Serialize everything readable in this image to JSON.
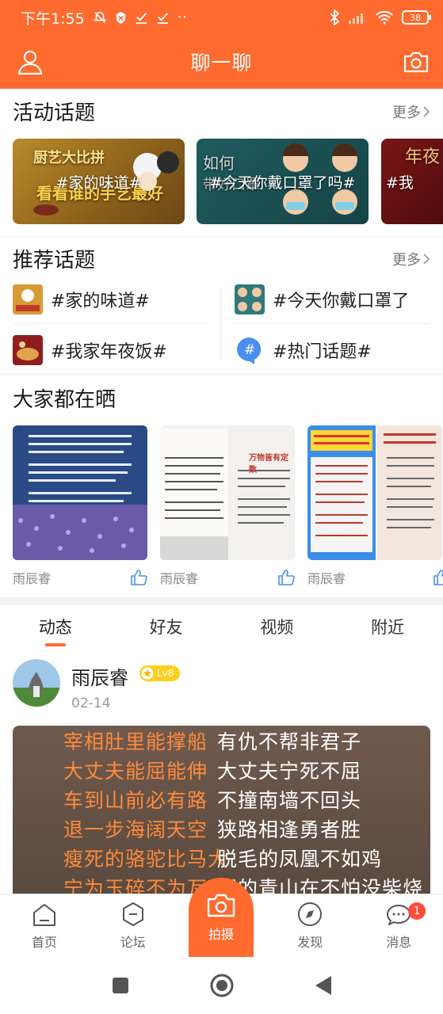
{
  "status_bar": {
    "time": "下午1:55",
    "battery": "38",
    "dots": "··"
  },
  "header": {
    "title": "聊一聊"
  },
  "activity": {
    "title": "活动话题",
    "more": "更多",
    "banners": [
      {
        "caption": "#家的味道#",
        "art_text": "厨艺大比拼 看看谁的手艺最好"
      },
      {
        "caption": "#今天你戴口罩了吗#",
        "art_text": "如何 带好口罩"
      },
      {
        "caption": "#我",
        "art_text": "年夜"
      }
    ]
  },
  "recommended": {
    "title": "推荐话题",
    "more": "更多",
    "topics": [
      {
        "label": "#家的味道#"
      },
      {
        "label": "#今天你戴口罩了"
      },
      {
        "label": "#我家年夜饭#"
      },
      {
        "label": "#热门话题#"
      }
    ]
  },
  "showcase": {
    "title": "大家都在晒",
    "posts": [
      {
        "author": "雨辰睿"
      },
      {
        "author": "雨辰睿",
        "overlay": "万物皆有定数"
      },
      {
        "author": "雨辰睿"
      }
    ]
  },
  "feed_tabs": [
    {
      "label": "动态",
      "active": true
    },
    {
      "label": "好友",
      "active": false
    },
    {
      "label": "视频",
      "active": false
    },
    {
      "label": "附近",
      "active": false
    }
  ],
  "post": {
    "username": "雨辰睿",
    "level": "Lv8",
    "date": "02-14",
    "lines_left": [
      "宰相肚里能撑船",
      "大丈夫能屈能伸",
      "车到山前必有路",
      "退一步海阔天空",
      "瘦死的骆驼比马大",
      "宁为玉碎不为瓦全"
    ],
    "lines_right": [
      "有仇不帮非君子",
      "大丈夫宁死不屈",
      "不撞南墙不回头",
      "狭路相逢勇者胜",
      "脱毛的凤凰不如鸡",
      "留的青山在不怕没柴烧"
    ]
  },
  "bottom_nav": {
    "items": [
      {
        "label": "首页",
        "icon": "home-icon"
      },
      {
        "label": "论坛",
        "icon": "forum-icon"
      },
      {
        "label": "发现",
        "icon": "discover-icon"
      },
      {
        "label": "消息",
        "icon": "message-icon",
        "badge": "1"
      }
    ],
    "center": {
      "label": "拍摄",
      "icon": "camera-icon"
    }
  },
  "colors": {
    "accent": "#ff6a2e",
    "level_badge": "#ffcf1a",
    "notify_badge": "#ff4d3d"
  }
}
